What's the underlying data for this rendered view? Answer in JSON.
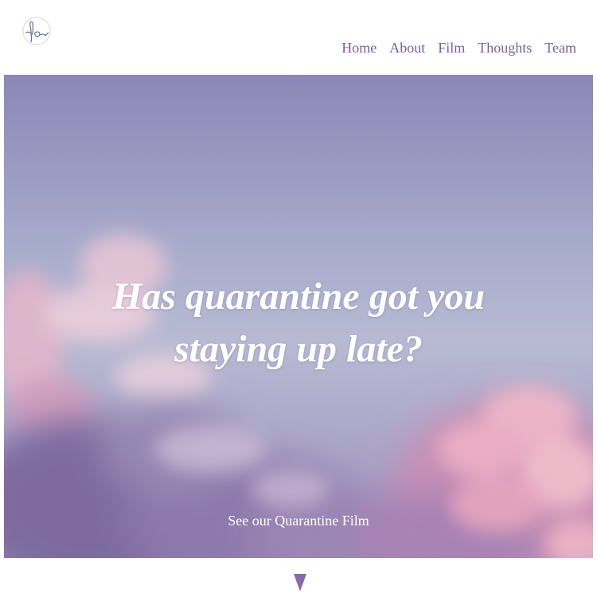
{
  "header": {
    "logo_icon": "handwritten-monogram-logo",
    "nav": [
      {
        "label": "Home"
      },
      {
        "label": "About"
      },
      {
        "label": "Film"
      },
      {
        "label": "Thoughts"
      },
      {
        "label": "Team"
      }
    ]
  },
  "hero": {
    "headline_line1": "Has quarantine got you",
    "headline_line2": "staying up late?",
    "cta_label": "See our Quarantine Film",
    "background": "pastel-pink-purple-cloudy-sky"
  },
  "scroll_indicator": {
    "icon": "down-triangle-icon"
  },
  "colors": {
    "nav_text": "#7a5f97",
    "accent": "#8a6aa8",
    "headline_text": "#ffffff"
  }
}
